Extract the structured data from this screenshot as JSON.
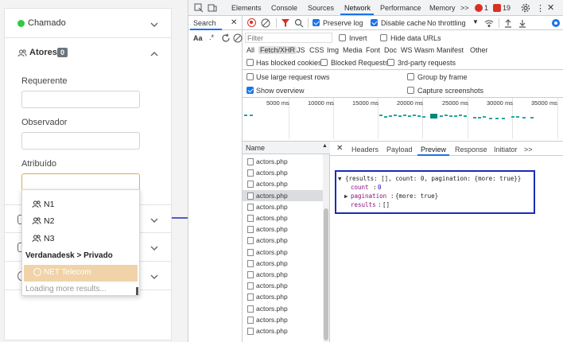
{
  "app": {
    "sections": {
      "chamado": "Chamado",
      "atores": "Atores",
      "atores_count": "0"
    },
    "fields": {
      "requerente": "Requerente",
      "observador": "Observador",
      "atribuido": "Atribuído"
    },
    "dropdown": {
      "items": [
        "N1",
        "N2",
        "N3"
      ],
      "group": "Verdanadesk > Privado",
      "selected": "NET Telecom",
      "loading": "Loading more results..."
    },
    "colors": {
      "status_dot": "#2ecc40",
      "selected_bg": "#f0d3a8",
      "annotation": "#1b2bb5"
    }
  },
  "devtools": {
    "tabs": [
      "Elements",
      "Console",
      "Sources",
      "Network",
      "Performance",
      "Memory"
    ],
    "active_tab": "Network",
    "more_tabs": ">>",
    "errors": "1",
    "warnings": "19",
    "search_tab": "Search",
    "search_opts": {
      "case": "Aa",
      "regex": ".*"
    },
    "toolbar": {
      "preserve_log": "Preserve log",
      "disable_cache": "Disable cache",
      "throttling": "No throttling"
    },
    "filter": {
      "placeholder": "Filter",
      "invert": "Invert",
      "hide_data_urls": "Hide data URLs"
    },
    "types": [
      "All",
      "Fetch/XHR",
      "JS",
      "CSS",
      "Img",
      "Media",
      "Font",
      "Doc",
      "WS",
      "Wasm",
      "Manifest",
      "Other"
    ],
    "active_type": "Fetch/XHR",
    "options": {
      "blocked_cookies": "Has blocked cookies",
      "blocked_requests": "Blocked Requests",
      "third_party": "3rd-party requests",
      "large_rows": "Use large request rows",
      "group_by_frame": "Group by frame",
      "show_overview": "Show overview",
      "capture_screenshots": "Capture screenshots"
    },
    "timeline_ticks": [
      "5000 ms",
      "10000 ms",
      "15000 ms",
      "20000 ms",
      "25000 ms",
      "30000 ms",
      "35000 ms"
    ],
    "name_header": "Name",
    "requests": [
      "actors.php",
      "actors.php",
      "actors.php",
      "actors.php",
      "actors.php",
      "actors.php",
      "actors.php",
      "actors.php",
      "actors.php",
      "actors.php",
      "actors.php",
      "actors.php",
      "actors.php",
      "actors.php",
      "actors.php",
      "actors.php"
    ],
    "detail_tabs": [
      "Headers",
      "Payload",
      "Preview",
      "Response",
      "Initiator"
    ],
    "active_detail_tab": "Preview",
    "detail_more": ">>",
    "preview": {
      "line1": "{results: [], count: 0, pagination: {more: true}}",
      "count_key": "count",
      "count_val": "0",
      "pagination_key": "pagination",
      "pagination_val": "{more: true}",
      "results_key": "results",
      "results_val": "[]"
    }
  }
}
